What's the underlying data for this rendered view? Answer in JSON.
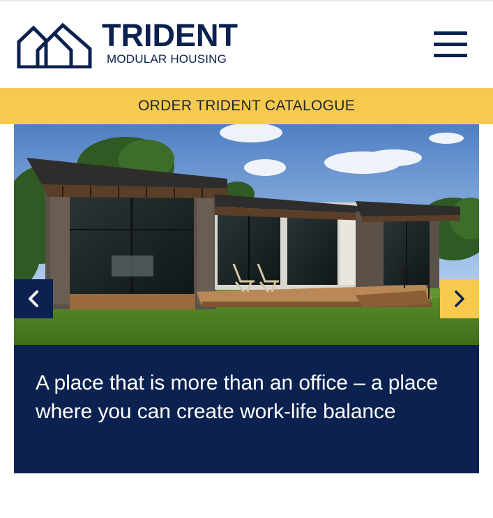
{
  "brand": {
    "name": "TRIDENT",
    "tagline": "MODULAR HOUSING",
    "logo_icon": "house-outline-icon",
    "color_primary": "#0b2150",
    "color_accent": "#f6c94f"
  },
  "header": {
    "menu_icon": "hamburger-menu-icon"
  },
  "catalogue_banner": {
    "label": "ORDER TRIDENT CATALOGUE"
  },
  "hero": {
    "image_subject": "modular house with deck, lawn and trees",
    "prev_icon": "chevron-left-icon",
    "next_icon": "chevron-right-icon",
    "caption": "A place that is more than an office – a place where you can create work-life balance"
  }
}
